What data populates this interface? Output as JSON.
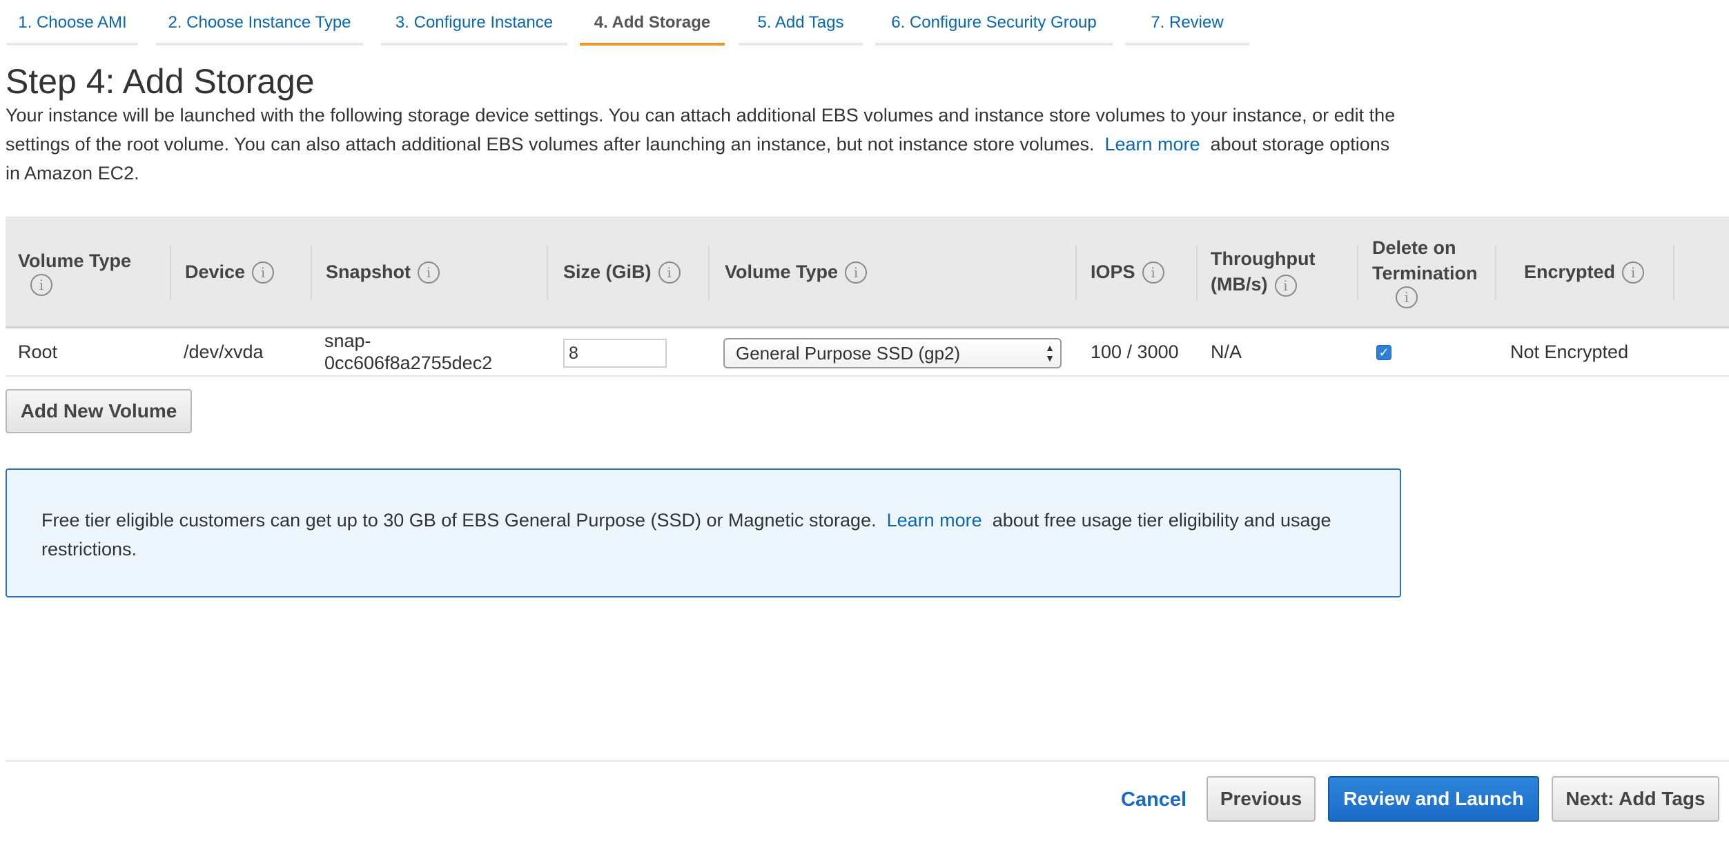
{
  "wizard": {
    "tabs": [
      {
        "label": "1. Choose AMI"
      },
      {
        "label": "2. Choose Instance Type"
      },
      {
        "label": "3. Configure Instance"
      },
      {
        "label": "4. Add Storage"
      },
      {
        "label": "5. Add Tags"
      },
      {
        "label": "6. Configure Security Group"
      },
      {
        "label": "7. Review"
      }
    ],
    "active_index": 3
  },
  "page": {
    "title": "Step 4: Add Storage",
    "intro_text": "Your instance will be launched with the following storage device settings. You can attach additional EBS volumes and instance store volumes to your instance, or edit the settings of the root volume. You can also attach additional EBS volumes after launching an instance, but not instance store volumes.",
    "intro_link": "Learn more",
    "intro_after": "about storage options in Amazon EC2."
  },
  "table": {
    "columns": {
      "volume_type": "Volume Type",
      "device": "Device",
      "snapshot": "Snapshot",
      "size": "Size (GiB)",
      "ebs_volume_type": "Volume Type",
      "iops": "IOPS",
      "throughput_line1": "Throughput",
      "throughput_line2": "(MB/s)",
      "delete_line1": "Delete on",
      "delete_line2": "Termination",
      "encrypted": "Encrypted"
    },
    "info_glyph": "i",
    "rows": [
      {
        "volume_type": "Root",
        "device": "/dev/xvda",
        "snapshot_line1": "snap-",
        "snapshot_line2": "0cc606f8a2755dec2",
        "size": "8",
        "ebs_volume_type": "General Purpose SSD (gp2)",
        "iops": "100 / 3000",
        "throughput": "N/A",
        "delete_on_termination": true,
        "encrypted": "Not Encrypted"
      }
    ]
  },
  "add_volume_label": "Add New Volume",
  "notice": {
    "text": "Free tier eligible customers can get up to 30 GB of EBS General Purpose (SSD) or Magnetic storage.",
    "link": "Learn more",
    "after": "about free usage tier eligibility and usage restrictions."
  },
  "footer": {
    "cancel": "Cancel",
    "previous": "Previous",
    "review_launch": "Review and Launch",
    "next": "Next: Add Tags"
  },
  "colors": {
    "link": "#0a67b2",
    "active_tab_underline": "#f0902c",
    "primary_button": "#1a6bc6",
    "notice_border": "#2b72b8",
    "notice_bg": "#eef6fd"
  },
  "icons": {
    "info": "info-circle-icon",
    "checkbox": "checkmark-icon",
    "select_arrows": "select-arrows-icon"
  }
}
